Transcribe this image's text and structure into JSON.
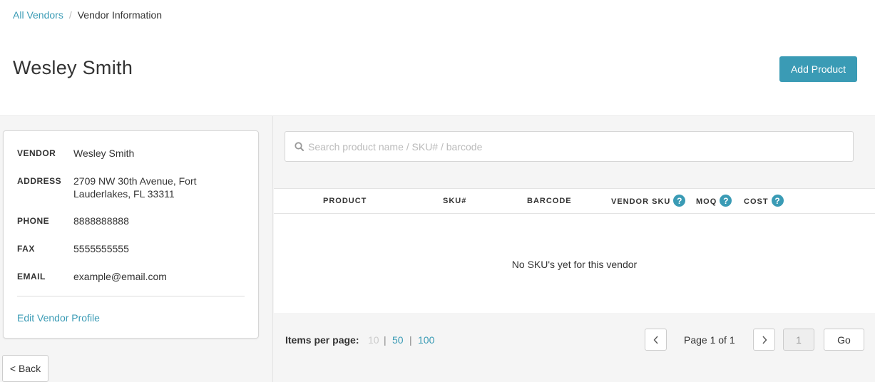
{
  "breadcrumb": {
    "items": [
      {
        "label": "All Vendors",
        "link": true
      },
      {
        "label": "Vendor Information",
        "link": false
      }
    ],
    "separator": "/"
  },
  "page": {
    "title": "Wesley Smith",
    "add_product_label": "Add Product"
  },
  "vendor": {
    "fields": [
      {
        "label": "VENDOR",
        "value": "Wesley Smith"
      },
      {
        "label": "ADDRESS",
        "value": "2709 NW 30th Avenue, Fort Lauderlakes, FL 33311"
      },
      {
        "label": "PHONE",
        "value": "8888888888"
      },
      {
        "label": "FAX",
        "value": "5555555555"
      },
      {
        "label": "EMAIL",
        "value": "example@email.com"
      }
    ],
    "edit_label": "Edit Vendor Profile"
  },
  "back_label": "< Back",
  "search": {
    "placeholder": "Search product name / SKU# / barcode",
    "icon": "search-icon"
  },
  "table": {
    "columns": [
      {
        "label": "PRODUCT",
        "help": false
      },
      {
        "label": "SKU#",
        "help": false
      },
      {
        "label": "BARCODE",
        "help": false
      },
      {
        "label": "VENDOR SKU",
        "help": true
      },
      {
        "label": "MOQ",
        "help": true
      },
      {
        "label": "COST",
        "help": true
      }
    ],
    "help_glyph": "?",
    "empty_message": "No SKU's yet for this vendor"
  },
  "pagination": {
    "items_per_page_label": "Items per page:",
    "options": [
      "10",
      "50",
      "100"
    ],
    "selected_option": "10",
    "separator": "|",
    "page_info": "Page 1 of 1",
    "current_page": "1",
    "go_label": "Go"
  },
  "colors": {
    "accent": "#3a9bb5",
    "background_gray": "#f5f5f5",
    "text": "#333333"
  }
}
